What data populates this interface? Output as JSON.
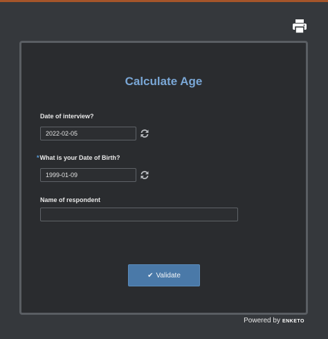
{
  "form": {
    "title": "Calculate Age",
    "fields": [
      {
        "label": "Date of interview?",
        "value": "2022-02-05",
        "required": false
      },
      {
        "label": "What is your Date of Birth?",
        "value": "1999-01-09",
        "required": true,
        "required_marker": "*"
      },
      {
        "label": "Name of respondent",
        "value": "",
        "required": false
      }
    ],
    "validate_label": "Validate"
  },
  "footer": {
    "powered_by": "Powered by",
    "brand": "ENKETO"
  },
  "icons": {
    "print": "printer-icon",
    "reset": "refresh-icon",
    "validate": "checkmark-icon"
  },
  "colors": {
    "background": "#35383c",
    "panel": "#2a2c2f",
    "accent": "#4a79a8",
    "title": "#7aa7d6",
    "top_bar": "#a5552a"
  }
}
